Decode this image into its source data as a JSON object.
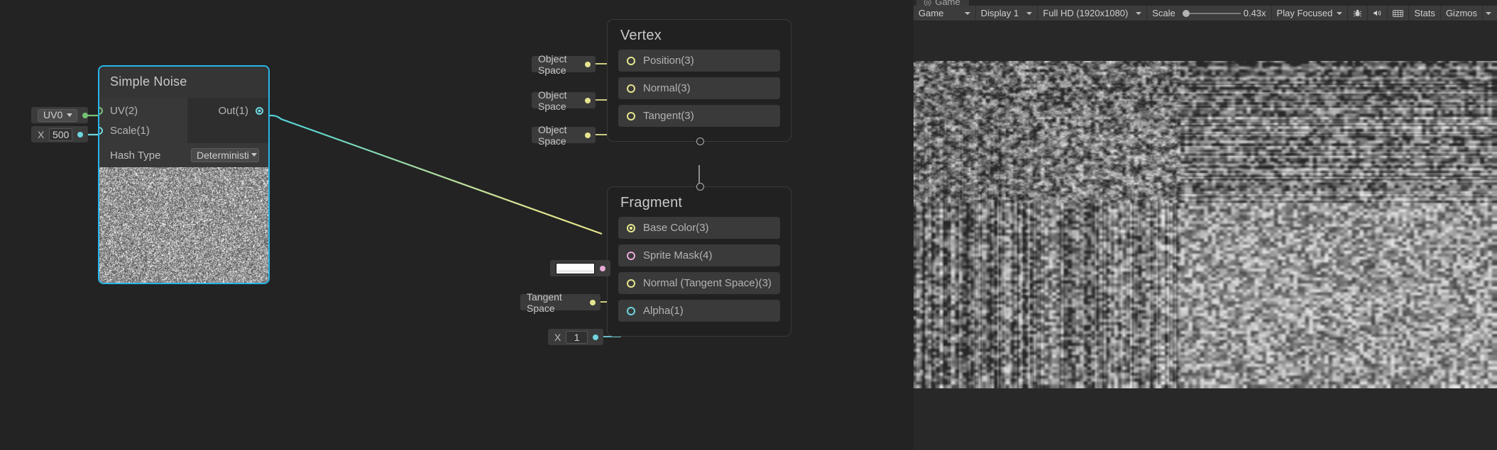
{
  "app": {
    "background_color": "#232323",
    "panel_color": "#282828"
  },
  "graph": {
    "property_nodes": [
      {
        "id": "uv0",
        "kind": "dropdown",
        "value": "UV0",
        "dot_color": "#74c274"
      },
      {
        "id": "scale500",
        "kind": "vector1",
        "axis": "X",
        "value": "500",
        "dot_color": "#6fd6e0"
      }
    ],
    "simple_noise": {
      "title": "Simple Noise",
      "selected": true,
      "selection_color": "#29b5e8",
      "inputs": [
        {
          "label": "UV(2)",
          "color": "#80c080"
        },
        {
          "label": "Scale(1)",
          "color": "#6fd6e0"
        }
      ],
      "outputs": [
        {
          "label": "Out(1)",
          "color": "#6fd6e0"
        }
      ],
      "properties": [
        {
          "label": "Hash Type",
          "value": "Deterministi",
          "type": "dropdown"
        }
      ],
      "preview": "procedural-noise-preview"
    },
    "vertex_node": {
      "title": "Vertex",
      "slots": [
        {
          "label": "Position(3)",
          "color": "#e5e58f",
          "default_node": "Object Space"
        },
        {
          "label": "Normal(3)",
          "color": "#e5e58f",
          "default_node": "Object Space"
        },
        {
          "label": "Tangent(3)",
          "color": "#e5e58f",
          "default_node": "Object Space"
        }
      ]
    },
    "fragment_node": {
      "title": "Fragment",
      "slots": [
        {
          "label": "Base Color(3)",
          "color": "#e5e58f",
          "connected": true,
          "default_node": null
        },
        {
          "label": "Sprite Mask(4)",
          "color": "#e8aad8",
          "connected": false,
          "default_node": "color-swatch-white"
        },
        {
          "label": "Normal (Tangent Space)(3)",
          "color": "#e5e58f",
          "connected": false,
          "default_node": "Tangent Space"
        },
        {
          "label": "Alpha(1)",
          "color": "#6fd6e0",
          "connected": false,
          "default_node": "X 1",
          "axis": "X",
          "value": "1"
        }
      ]
    },
    "connections": [
      {
        "from": "simple_noise.Out(1)",
        "to": "fragment.Base Color(3)",
        "start_color": "#4fd0e0",
        "end_color": "#e5e58f"
      },
      {
        "from": "uv0",
        "to": "simple_noise.UV(2)",
        "color": "#74c274"
      },
      {
        "from": "scale500",
        "to": "simple_noise.Scale(1)",
        "color": "#6fd6e0"
      },
      {
        "from": "vertex.bottom",
        "to": "fragment.top",
        "color": "#b0b0b0"
      }
    ]
  },
  "game_view": {
    "tab_label": "Game",
    "tab_icon": "game-controller-icon",
    "toolbar": {
      "view_mode": "Game",
      "display": "Display 1",
      "resolution": "Full HD (1920x1080)",
      "scale_label": "Scale",
      "scale_value": "0.43x",
      "play_mode": "Play Focused",
      "buttons": [
        {
          "name": "debug-bug-icon",
          "label": ""
        },
        {
          "name": "mute-audio-icon",
          "label": ""
        },
        {
          "name": "frame-debugger-icon",
          "label": ""
        },
        {
          "name": "stats-button",
          "label": "Stats"
        },
        {
          "name": "gizmos-button",
          "label": "Gizmos"
        }
      ]
    },
    "content": "horizontally-stretched-grayscale-noise"
  }
}
